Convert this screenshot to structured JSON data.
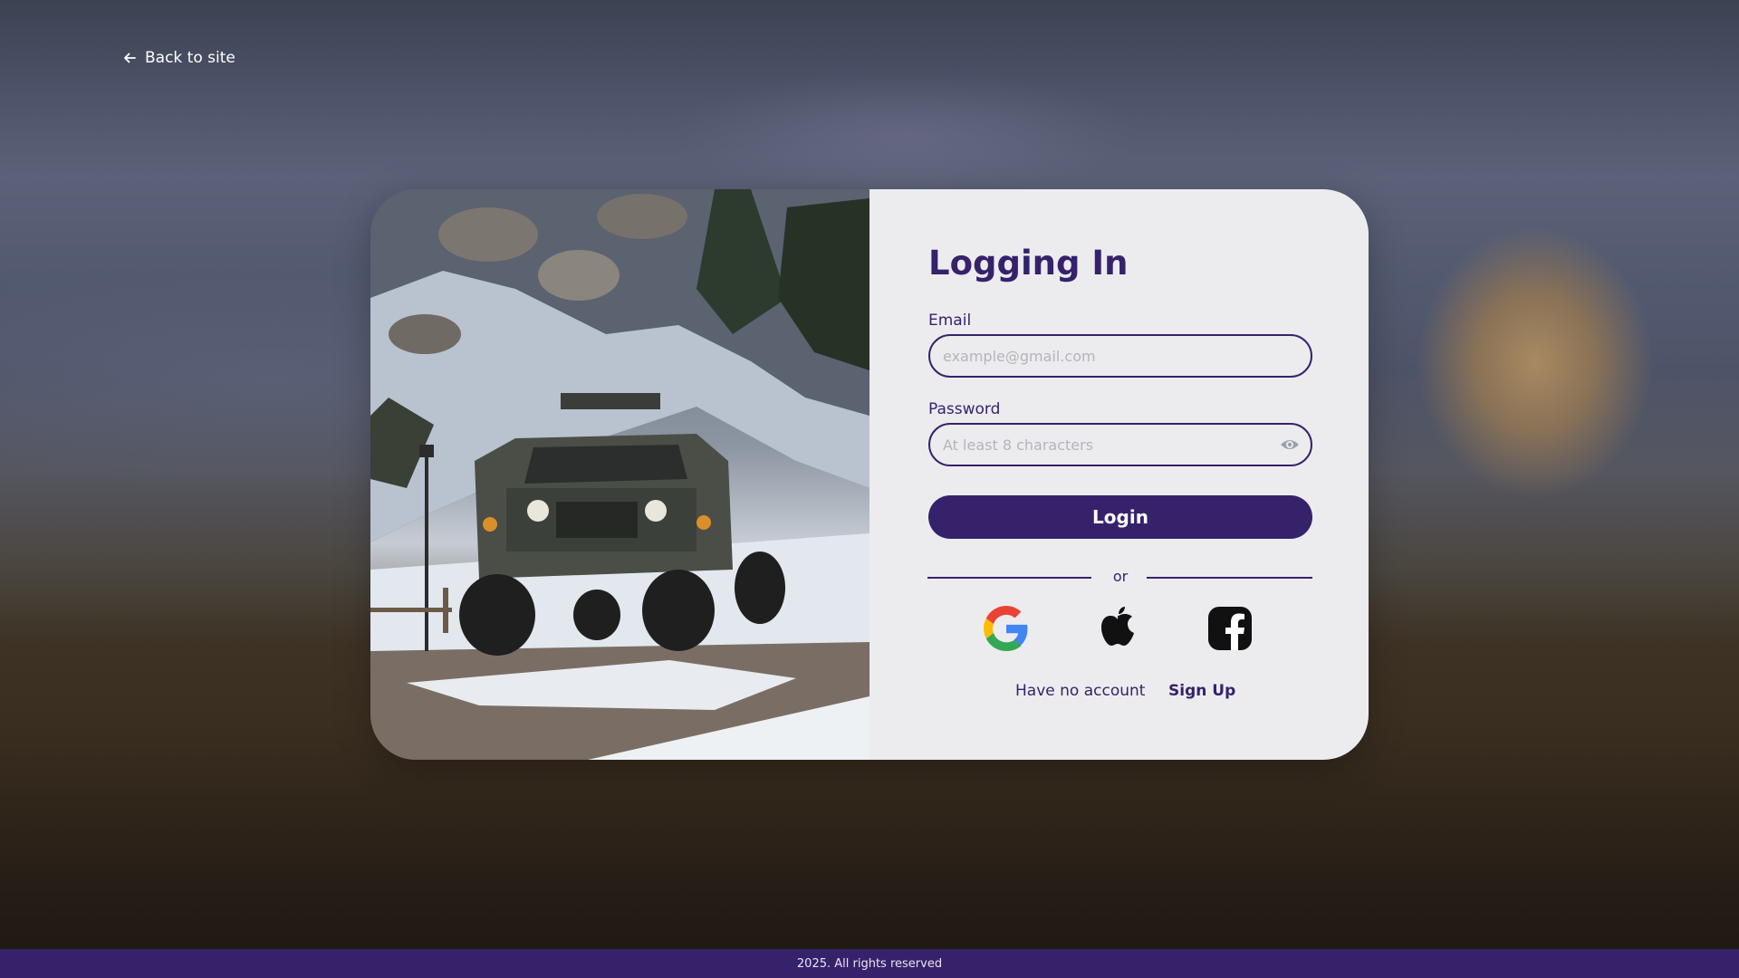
{
  "nav": {
    "back_label": "Back to site",
    "back_icon": "arrow-left-icon"
  },
  "login": {
    "title": "Logging In",
    "email_label": "Email",
    "email_placeholder": "example@gmail.com",
    "password_label": "Password",
    "password_placeholder": "At least 8 characters",
    "password_toggle_icon": "eye-icon",
    "submit_label": "Login",
    "divider_text": "or",
    "social_icons": [
      "google-icon",
      "apple-icon",
      "facebook-icon"
    ],
    "no_account_text": "Have no account",
    "signup_label": "Sign Up"
  },
  "footer": {
    "text": "2025. All rights reserved"
  },
  "colors": {
    "accent": "#36226b",
    "panel_bg": "#ececef",
    "placeholder": "#b4b4bd"
  }
}
